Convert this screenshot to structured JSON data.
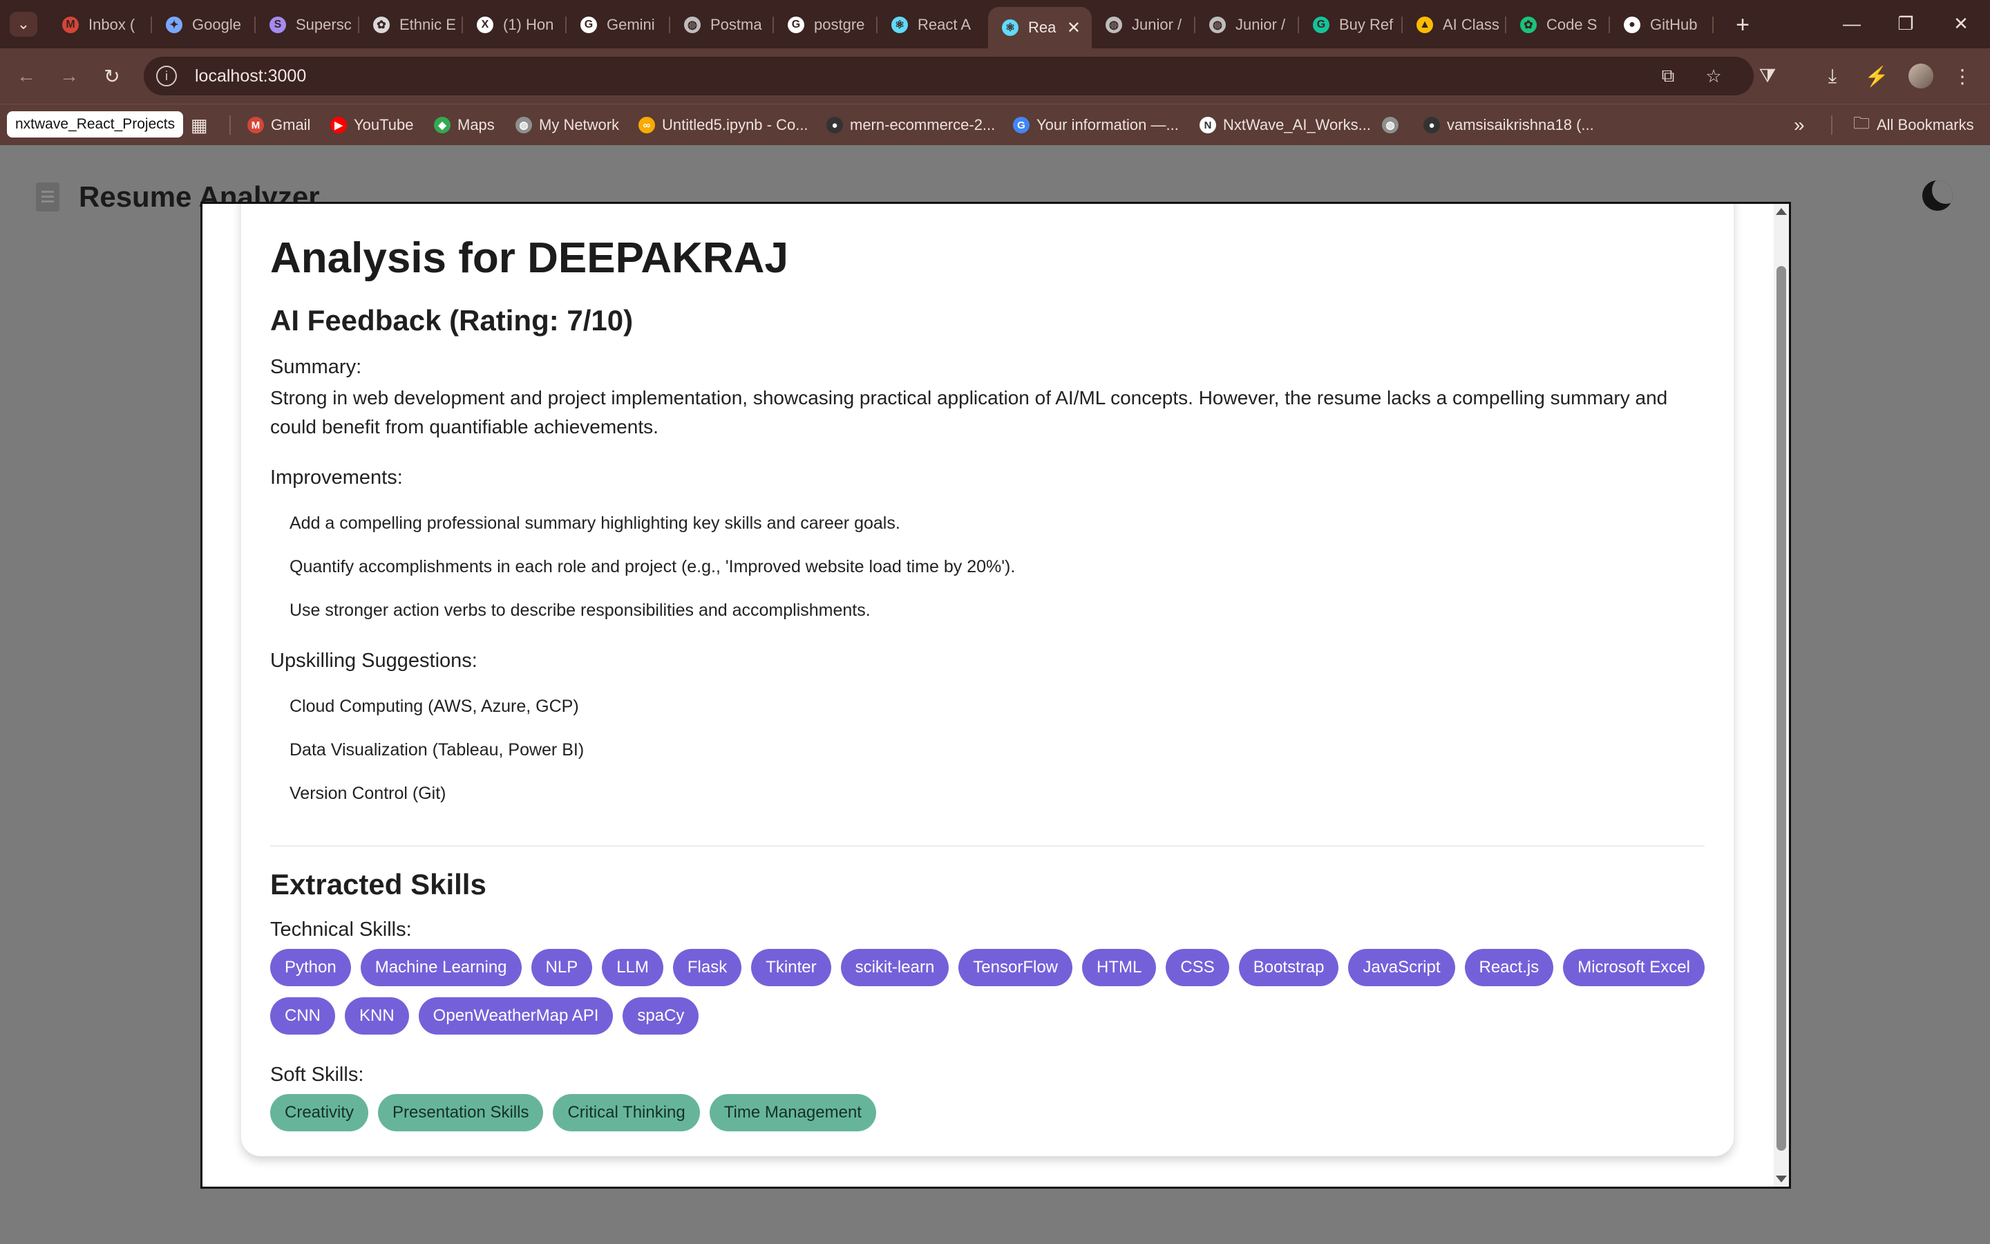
{
  "browser": {
    "tabs": [
      {
        "title": "Inbox (",
        "icon": "gmail-icon",
        "color": "#d44638",
        "glyph": "M"
      },
      {
        "title": "Google",
        "icon": "gemini-icon",
        "color": "#7aa7ff",
        "glyph": "✦"
      },
      {
        "title": "Supersc",
        "icon": "superscript-icon",
        "color": "#a48cf0",
        "glyph": "S"
      },
      {
        "title": "Ethnic E",
        "icon": "openai-icon",
        "color": "#d9d9d9",
        "glyph": "✿"
      },
      {
        "title": "(1) Hon",
        "icon": "x-icon",
        "color": "#ffffff",
        "glyph": "X"
      },
      {
        "title": "Gemini",
        "icon": "google-icon",
        "color": "#ffffff",
        "glyph": "G"
      },
      {
        "title": "Postma",
        "icon": "globe-icon",
        "color": "#bdbdbd",
        "glyph": "◍"
      },
      {
        "title": "postgre",
        "icon": "google-icon",
        "color": "#ffffff",
        "glyph": "G"
      },
      {
        "title": "React A",
        "icon": "react-icon",
        "color": "#61dafb",
        "glyph": "⚛"
      },
      {
        "title": "Rea",
        "icon": "react-icon",
        "color": "#61dafb",
        "glyph": "⚛"
      },
      {
        "title": "Junior /",
        "icon": "globe-icon",
        "color": "#bdbdbd",
        "glyph": "◍"
      },
      {
        "title": "Junior /",
        "icon": "globe-icon",
        "color": "#bdbdbd",
        "glyph": "◍"
      },
      {
        "title": "Buy Ref",
        "icon": "grammarly-icon",
        "color": "#15c39a",
        "glyph": "G"
      },
      {
        "title": "AI Class",
        "icon": "drive-icon",
        "color": "#fbbc04",
        "glyph": "▲"
      },
      {
        "title": "Code S",
        "icon": "openai-icon",
        "color": "#19c37d",
        "glyph": "✿"
      },
      {
        "title": "GitHub",
        "icon": "github-icon",
        "color": "#ffffff",
        "glyph": "●"
      }
    ],
    "url": "localhost:3000",
    "bookmarks": [
      {
        "label": "Gmail",
        "icon": "gmail-icon",
        "color": "#d44638",
        "glyph": "M"
      },
      {
        "label": "YouTube",
        "icon": "youtube-icon",
        "color": "#ff0000",
        "glyph": "▶"
      },
      {
        "label": "Maps",
        "icon": "maps-icon",
        "color": "#34a853",
        "glyph": "◆"
      },
      {
        "label": "My Network",
        "icon": "globe-icon",
        "color": "#8f8f8f",
        "glyph": "◍"
      },
      {
        "label": "Untitled5.ipynb - Co...",
        "icon": "colab-icon",
        "color": "#f9ab00",
        "glyph": "∞"
      },
      {
        "label": "mern-ecommerce-2...",
        "icon": "github-icon",
        "color": "#333333",
        "glyph": "●"
      },
      {
        "label": "Your information —...",
        "icon": "google-icon",
        "color": "#4285f4",
        "glyph": "G"
      },
      {
        "label": "NxtWave_AI_Works...",
        "icon": "nxtwave-icon",
        "color": "#ffffff",
        "glyph": "N"
      },
      {
        "label": "",
        "icon": "globe-icon",
        "color": "#8f8f8f",
        "glyph": "◍"
      },
      {
        "label": "vamsisaikrishna18 (...",
        "icon": "github-icon",
        "color": "#333333",
        "glyph": "●"
      }
    ],
    "bookmark_group": "nxtwave_React_Projects",
    "all_bookmarks": "All Bookmarks"
  },
  "app": {
    "title": "Resume Analyzer"
  },
  "analysis": {
    "heading": "Analysis for DEEPAKRAJ",
    "feedback_heading": "AI Feedback (Rating: 7/10)",
    "summary_label": "Summary:",
    "summary_text": "Strong in web development and project implementation, showcasing practical application of AI/ML concepts. However, the resume lacks a compelling summary and could benefit from quantifiable achievements.",
    "improvements_label": "Improvements:",
    "improvements": [
      "Add a compelling professional summary highlighting key skills and career goals.",
      "Quantify accomplishments in each role and project (e.g., 'Improved website load time by 20%').",
      "Use stronger action verbs to describe responsibilities and accomplishments."
    ],
    "upskilling_label": "Upskilling Suggestions:",
    "upskilling": [
      "Cloud Computing (AWS, Azure, GCP)",
      "Data Visualization (Tableau, Power BI)",
      "Version Control (Git)"
    ],
    "skills_heading": "Extracted Skills",
    "technical_label": "Technical Skills:",
    "technical_skills": [
      "Python",
      "Machine Learning",
      "NLP",
      "LLM",
      "Flask",
      "Tkinter",
      "scikit-learn",
      "TensorFlow",
      "HTML",
      "CSS",
      "Bootstrap",
      "JavaScript",
      "React.js",
      "Microsoft Excel",
      "CNN",
      "KNN",
      "OpenWeatherMap API",
      "spaCy"
    ],
    "soft_label": "Soft Skills:",
    "soft_skills": [
      "Creativity",
      "Presentation Skills",
      "Critical Thinking",
      "Time Management"
    ]
  },
  "colors": {
    "technical_pill": "#7461d9",
    "soft_pill": "#66b59a",
    "chrome": "#5b3c36",
    "overlay": "#7b7b7b"
  }
}
